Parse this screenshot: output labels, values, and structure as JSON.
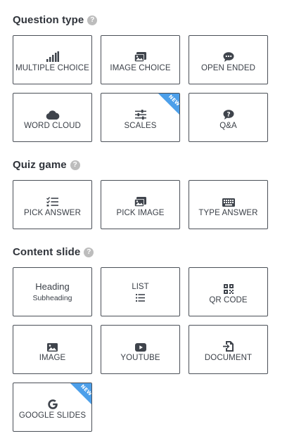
{
  "sections": {
    "question_type": {
      "title": "Question type",
      "help": "?"
    },
    "quiz_game": {
      "title": "Quiz game",
      "help": "?"
    },
    "content_slide": {
      "title": "Content slide",
      "help": "?"
    }
  },
  "question_type_cards": [
    {
      "label": "MULTIPLE CHOICE",
      "icon": "bar-chart-icon"
    },
    {
      "label": "IMAGE CHOICE",
      "icon": "images-icon"
    },
    {
      "label": "OPEN ENDED",
      "icon": "chat-bubble-icon"
    },
    {
      "label": "WORD CLOUD",
      "icon": "cloud-icon"
    },
    {
      "label": "SCALES",
      "icon": "sliders-icon",
      "badge": "NEW"
    },
    {
      "label": "Q&A",
      "icon": "question-bubble-icon"
    }
  ],
  "quiz_game_cards": [
    {
      "label": "PICK ANSWER",
      "icon": "checklist-icon"
    },
    {
      "label": "PICK IMAGE",
      "icon": "images-icon"
    },
    {
      "label": "TYPE ANSWER",
      "icon": "keyboard-icon"
    }
  ],
  "content_slide_cards": {
    "heading": {
      "main": "Heading",
      "sub": "Subheading"
    },
    "list": {
      "label": "LIST",
      "icon": "list-icon"
    },
    "qr_code": {
      "label": "QR CODE",
      "icon": "qr-code-icon"
    },
    "image": {
      "label": "IMAGE",
      "icon": "image-icon"
    },
    "youtube": {
      "label": "YOUTUBE",
      "icon": "youtube-icon"
    },
    "document": {
      "label": "DOCUMENT",
      "icon": "document-import-icon"
    },
    "google_slides": {
      "label": "GOOGLE SLIDES",
      "icon": "google-icon",
      "badge": "NEW"
    }
  },
  "colors": {
    "ribbon": "#4c9fea",
    "icon": "#3f444c",
    "border": "#4a4f57"
  }
}
